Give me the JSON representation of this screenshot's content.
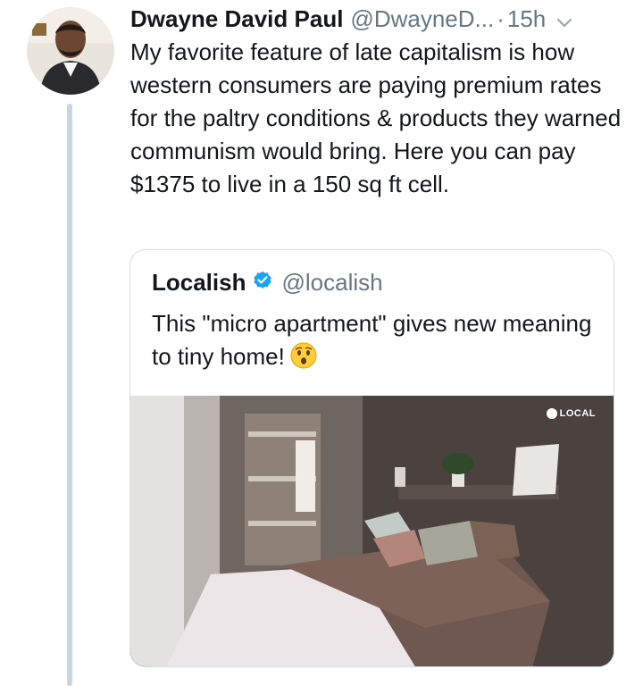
{
  "tweet": {
    "author_name": "Dwayne David Paul",
    "author_handle": "@DwayneD...",
    "separator": "·",
    "time": "15h",
    "text": "My favorite feature of late capitalism is how western consumers are paying premium rates for the paltry conditions & products they warned communism would bring. Here you can pay $1375 to live in a 150 sq ft cell."
  },
  "quoted_tweet": {
    "author_name": "Localish",
    "author_handle": "@localish",
    "verified": true,
    "text": "This \"micro apartment\" gives new meaning to tiny home!",
    "emoji": "hushed-face",
    "media": {
      "type": "video-thumbnail",
      "description_icon": "bedroom-image",
      "watermark": "LOCAL"
    }
  },
  "colors": {
    "text": "#14171a",
    "secondary": "#657786",
    "verified": "#1da1f2",
    "thread_line": "#c9d5e0",
    "border": "#d5dde4"
  }
}
